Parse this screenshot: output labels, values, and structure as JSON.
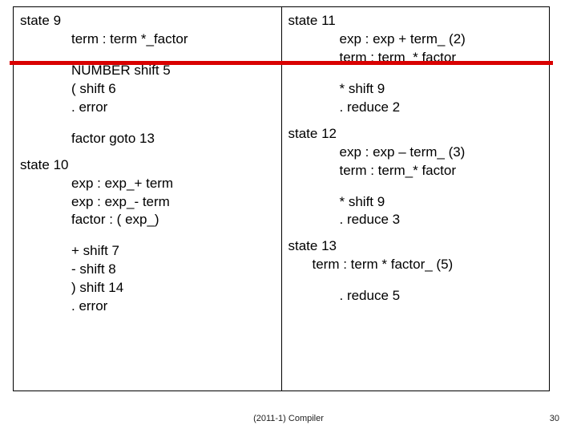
{
  "left": {
    "s9": {
      "header": "state 9",
      "l1": "term : term *_factor",
      "l2": "NUMBER shift 5",
      "l3": "( shift 6",
      "l4": ". error",
      "l5": "factor goto 13"
    },
    "s10": {
      "header": "state 10",
      "l1": "exp : exp_+ term",
      "l2": "exp : exp_- term",
      "l3": "factor : ( exp_)",
      "l4": "+ shift 7",
      "l5": "- shift 8",
      "l6": ") shift 14",
      "l7": ". error"
    }
  },
  "right": {
    "s11": {
      "header": "state 11",
      "l1": "exp : exp + term_ (2)",
      "l2": "term : term_* factor",
      "l3": "* shift 9",
      "l4": ". reduce 2"
    },
    "s12": {
      "header": "state 12",
      "l1": "exp : exp – term_ (3)",
      "l2": "term : term_* factor",
      "l3": "* shift 9",
      "l4": ". reduce 3"
    },
    "s13": {
      "header": "state 13",
      "l1": "term : term * factor_ (5)",
      "l2": ". reduce 5"
    }
  },
  "footer": {
    "center": "(2011-1) Compiler",
    "page": "30"
  }
}
